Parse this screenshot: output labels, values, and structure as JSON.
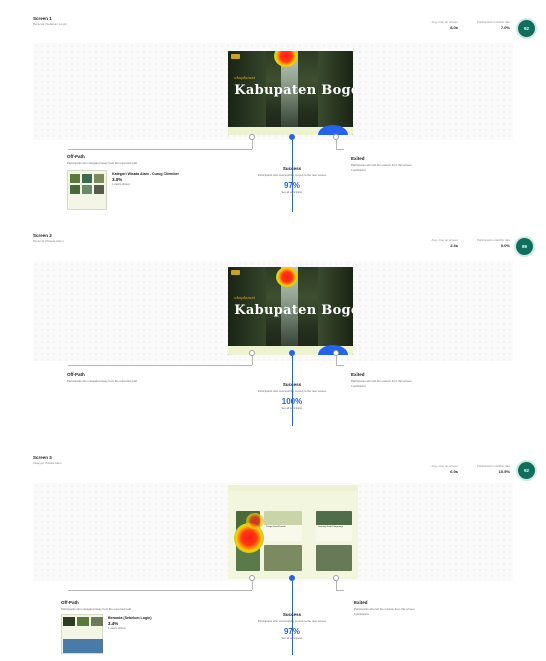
{
  "screens": [
    {
      "title": "Screen 1",
      "subtitle": "Beranda (Sebelum Login)",
      "stat1_label": "Avg. time on screen",
      "stat1_value": "8.0s",
      "stat2_label": "Participants misclick rate",
      "stat2_value": "7.0%",
      "score": "92",
      "hero_small": "eksplorasi",
      "hero_big": "Kabupaten Bogor",
      "offpath": {
        "title": "Off-Path",
        "desc": "Participants who navigated away from the expected path",
        "item_name": "Kategori Wisata Alam - Curug Cilember",
        "item_pct": "3.0%",
        "item_link": "1 view/s clicked"
      },
      "success": {
        "title": "Success",
        "desc": "Participants who successfully moved to the next screen",
        "pct": "97%",
        "link": "See all participants"
      },
      "exited": {
        "title": "Exited",
        "desc": "Participants who left the mission from this screen",
        "link": "0 participants"
      }
    },
    {
      "title": "Screen 2",
      "subtitle": "Beranda (Wisata Alam)",
      "stat1_label": "Avg. time on screen",
      "stat1_value": "2.4s",
      "stat2_label": "Participants misclick rate",
      "stat2_value": "0.0%",
      "score": "89",
      "hero_small": "eksplorasi",
      "hero_big": "Kabupaten Bogor",
      "offpath": {
        "title": "Off-Path",
        "desc": "Participants who navigated away from the expected path"
      },
      "success": {
        "title": "Success",
        "desc": "Participants who successfully moved to the next screen",
        "pct": "100%",
        "link": "See all participants"
      },
      "exited": {
        "title": "Exited",
        "desc": "Participants who left the mission from this screen",
        "link": "0 participants"
      }
    },
    {
      "title": "Screen 3",
      "subtitle": "Kategori Wisata Alam",
      "stat1_label": "Avg. time on screen",
      "stat1_value": "6.9s",
      "stat2_label": "Participants misclick rate",
      "stat2_value": "10.5%",
      "score": "92",
      "card_titles": [
        "Telaga Saat Puncak",
        "Gunung Gede Pangrango"
      ],
      "offpath": {
        "title": "Off-Path",
        "desc": "Participants who navigated away from the expected path",
        "item_name": "Beranda (Sebelum Login)",
        "item_pct": "3.4%",
        "item_link": "1 view/s clicked"
      },
      "success": {
        "title": "Success",
        "desc": "Participants who successfully moved to the next screen",
        "pct": "97%",
        "link": "See all participants"
      },
      "exited": {
        "title": "Exited",
        "desc": "Participants who left the mission from this screen",
        "link": "0 participants"
      }
    }
  ],
  "colors": {
    "accent": "#2563eb",
    "score_badge": "#0f6e5c",
    "page_bg": "#ffffff"
  }
}
